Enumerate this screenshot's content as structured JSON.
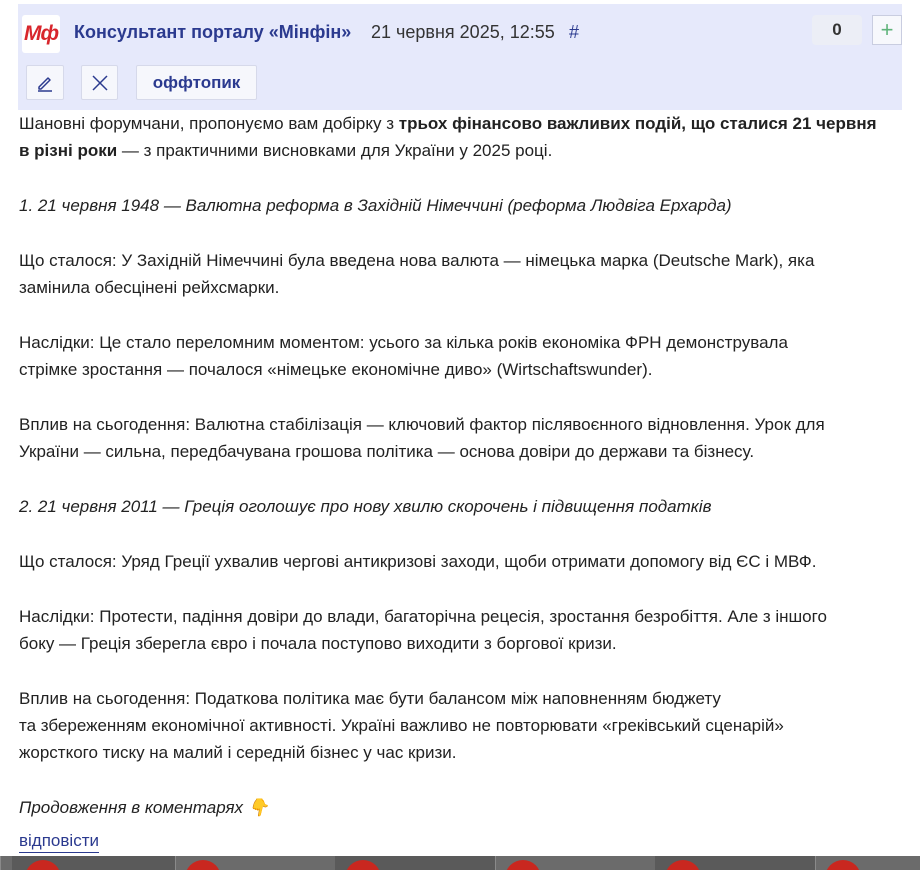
{
  "header": {
    "logo_text": "Мф",
    "author": "Консультант порталу «Мінфін»",
    "date": "21 червня 2025, 12:55",
    "permalink": "#",
    "vote_count": "0",
    "vote_plus": "+",
    "offtopic_label": "оффтопик"
  },
  "body": {
    "intro_plain_1": "Шановні форумчани, пропонуємо вам добірку з ",
    "intro_bold_1": "трьох фінансово важливих подій, що сталися 21 червня",
    "intro_bold_2": "в різні роки",
    "intro_plain_2": " — з практичними висновками для України у 2025 році.",
    "event1_title": "1. 21 червня 1948 — Валютна реформа в Західній Німеччині (реформа Людвіга Ерхарда)",
    "event1_what_1": "Що сталося: У Західній Німеччині була введена нова валюта — німецька марка (Deutsche Mark), яка",
    "event1_what_2": "замінила обесцінені рейхсмарки.",
    "event1_cons_1": "Наслідки: Це стало переломним моментом: усього за кілька років економіка ФРН демонструвала",
    "event1_cons_2": "стрімке зростання — почалося «німецьке економічне диво» (Wirtschaftswunder).",
    "event1_impact_1": "Вплив на сьогодення: Валютна стабілізація — ключовий фактор післявоєнного відновлення. Урок для",
    "event1_impact_2": "України — сильна, передбачувана грошова політика — основа довіри до держави та бізнесу.",
    "event2_title": "2. 21 червня 2011 — Греція оголошує про нову хвилю скорочень і підвищення податків",
    "event2_what_1": "Що сталося: Уряд Греції ухвалив чергові антикризові заходи, щоби отримати допомогу від ЄС і МВФ.",
    "event2_cons_1": "Наслідки: Протести, падіння довіри до влади, багаторічна рецесія, зростання безробіття. Але з іншого",
    "event2_cons_2": "боку — Греція зберегла євро і почала поступово виходити з боргової кризи.",
    "event2_impact_1": "Вплив на сьогодення: Податкова політика має бути балансом між наповненням бюджету",
    "event2_impact_2": "та збереженням економічної активності. Україні важливо не повторювати «греківський сценарій»",
    "event2_impact_3": "жорсткого тиску на малий і середній бізнес у час кризи.",
    "continuation": "Продовження в коментарях 👇"
  },
  "footer": {
    "reply_label": "відповісти"
  },
  "icons": {
    "edit": "pencil-icon",
    "delete": "close-icon",
    "hand": "hand-pointing-down-icon"
  },
  "colors": {
    "header_bg": "#e6e9fb",
    "link": "#2b3a8f",
    "logo": "#d8262c",
    "plus": "#5fb37a"
  }
}
